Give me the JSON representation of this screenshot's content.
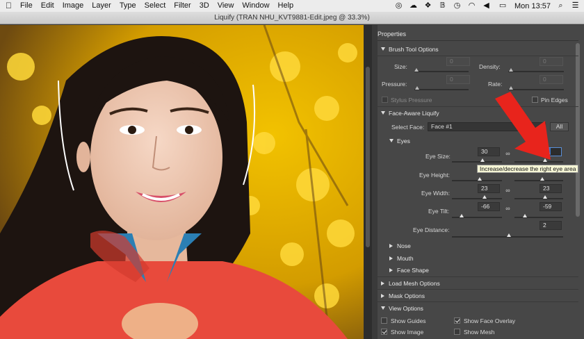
{
  "menubar": {
    "items": [
      "File",
      "Edit",
      "Image",
      "Layer",
      "Type",
      "Select",
      "Filter",
      "3D",
      "View",
      "Window",
      "Help"
    ],
    "clock": "Mon 13:57"
  },
  "window": {
    "title": "Liquify (TRAN NHU_KVT9881-Edit.jpeg @ 33.3%)"
  },
  "panel": {
    "title": "Properties",
    "brush": {
      "header": "Brush Tool Options",
      "size_label": "Size:",
      "density_label": "Density:",
      "pressure_label": "Pressure:",
      "rate_label": "Rate:",
      "size_value": "0",
      "density_value": "0",
      "pressure_value": "0",
      "rate_value": "0",
      "stylus_label": "Stylus Pressure",
      "pin_edges_label": "Pin Edges"
    },
    "face": {
      "header": "Face-Aware Liquify",
      "select_face_label": "Select Face:",
      "select_face_value": "Face #1",
      "all_button": "All",
      "eyes_header": "Eyes",
      "eye_size_label": "Eye Size:",
      "eye_size_left": "30",
      "eye_size_right": "31",
      "eye_height_label": "Eye Height:",
      "eye_width_label": "Eye Width:",
      "eye_width_left": "23",
      "eye_width_right": "23",
      "eye_tilt_label": "Eye Tilt:",
      "eye_tilt_left": "-66",
      "eye_tilt_right": "-59",
      "eye_distance_label": "Eye Distance:",
      "eye_distance_value": "2",
      "nose": "Nose",
      "mouth": "Mouth",
      "face_shape": "Face Shape"
    },
    "load_mesh": "Load Mesh Options",
    "mask": "Mask Options",
    "view": {
      "header": "View Options",
      "show_guides": "Show Guides",
      "show_face_overlay": "Show Face Overlay",
      "show_image": "Show Image",
      "show_mesh": "Show Mesh",
      "show_guides_checked": false,
      "show_face_overlay_checked": true,
      "show_image_checked": true,
      "show_mesh_checked": false
    }
  },
  "tooltip": {
    "text": "Increase/decrease the right eye area"
  },
  "colors": {
    "accent_arrow": "#e8241c",
    "panel_bg": "#474747"
  }
}
